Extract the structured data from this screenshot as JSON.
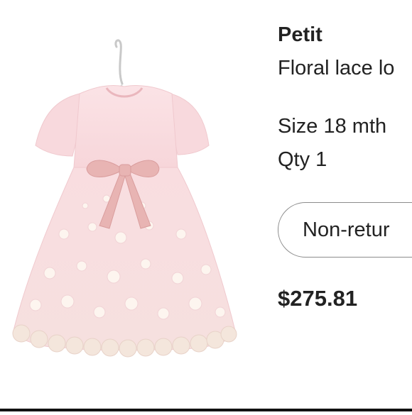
{
  "product": {
    "brand": "Petit",
    "name": "Floral lace lo",
    "size": "Size 18 mth",
    "quantity": "Qty 1",
    "return_policy": "Non-retur",
    "price": "$275.81",
    "image": "pink-floral-lace-baby-dress-on-hanger"
  },
  "colors": {
    "text": "#222222",
    "badge_border": "#8c8c8c",
    "dress_pink": "#f9dde0",
    "bow_pink": "#e8b4b3"
  }
}
